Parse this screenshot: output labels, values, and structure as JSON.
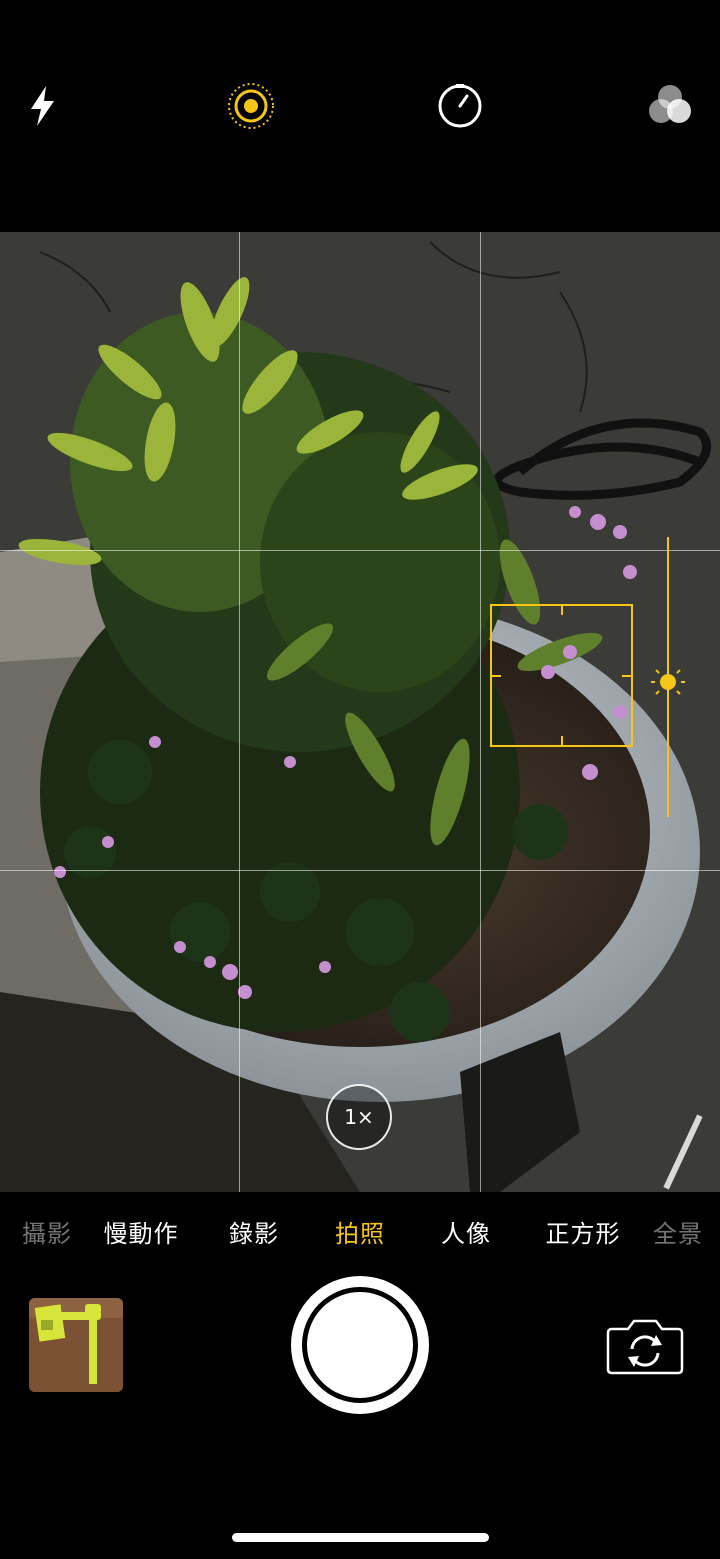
{
  "top_bar": {
    "icons": [
      "flash-icon",
      "live-photo-icon",
      "timer-icon",
      "filters-icon"
    ],
    "live_photo_active": true
  },
  "viewfinder": {
    "zoom_label": "1×",
    "grid": true,
    "focus_lock_color": "#f5c518"
  },
  "modes": {
    "items": [
      "攝影",
      "慢動作",
      "錄影",
      "拍照",
      "人像",
      "正方形",
      "全景"
    ],
    "selected": "拍照"
  },
  "controls": {
    "thumbnail": "last-photo-thumbnail",
    "shutter": "shutter-button",
    "switch_camera": "switch-camera-icon"
  },
  "colors": {
    "accent": "#f5c518",
    "background": "#000000"
  }
}
